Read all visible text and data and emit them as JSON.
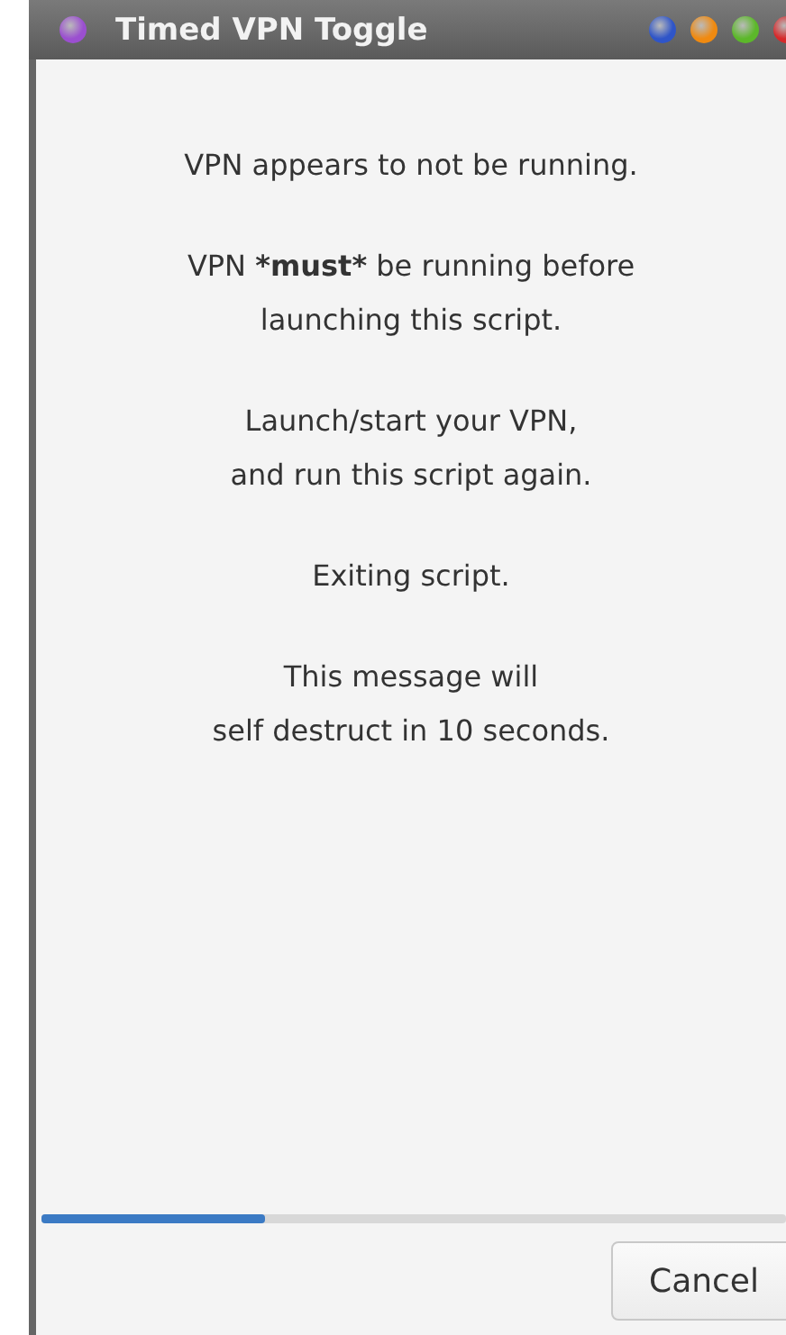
{
  "window": {
    "title": "Timed VPN Toggle"
  },
  "message": [
    {
      "lines": [
        [
          {
            "text": "VPN appears to not be running.",
            "bold": false
          }
        ]
      ]
    },
    {
      "lines": [
        [
          {
            "text": "VPN ",
            "bold": false
          },
          {
            "text": "*must*",
            "bold": true
          },
          {
            "text": " be running before",
            "bold": false
          }
        ],
        [
          {
            "text": "launching this script.",
            "bold": false
          }
        ]
      ]
    },
    {
      "lines": [
        [
          {
            "text": "Launch/start your VPN,",
            "bold": false
          }
        ],
        [
          {
            "text": "and run this script again.",
            "bold": false
          }
        ]
      ]
    },
    {
      "lines": [
        [
          {
            "text": "Exiting script.",
            "bold": false
          }
        ]
      ]
    },
    {
      "lines": [
        [
          {
            "text": "This message will",
            "bold": false
          }
        ],
        [
          {
            "text": "self destruct in 10 seconds.",
            "bold": false
          }
        ]
      ]
    }
  ],
  "progress": {
    "level": 0.3
  },
  "buttons": [
    {
      "label": "Cancel"
    }
  ]
}
